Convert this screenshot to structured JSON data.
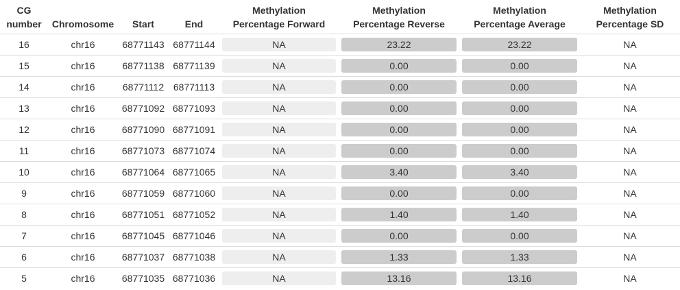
{
  "headers": {
    "cg_number": [
      "CG",
      "number"
    ],
    "chromosome": "Chromosome",
    "start": "Start",
    "end": "End",
    "forward": [
      "Methylation",
      "Percentage Forward"
    ],
    "reverse": [
      "Methylation",
      "Percentage Reverse"
    ],
    "average": [
      "Methylation",
      "Percentage Average"
    ],
    "sd": [
      "Methylation",
      "Percentage SD"
    ]
  },
  "rows": [
    {
      "cg": "16",
      "chr": "chr16",
      "start": "68771143",
      "end": "68771144",
      "forward": "NA",
      "reverse": "23.22",
      "average": "23.22",
      "sd": "NA"
    },
    {
      "cg": "15",
      "chr": "chr16",
      "start": "68771138",
      "end": "68771139",
      "forward": "NA",
      "reverse": "0.00",
      "average": "0.00",
      "sd": "NA"
    },
    {
      "cg": "14",
      "chr": "chr16",
      "start": "68771112",
      "end": "68771113",
      "forward": "NA",
      "reverse": "0.00",
      "average": "0.00",
      "sd": "NA"
    },
    {
      "cg": "13",
      "chr": "chr16",
      "start": "68771092",
      "end": "68771093",
      "forward": "NA",
      "reverse": "0.00",
      "average": "0.00",
      "sd": "NA"
    },
    {
      "cg": "12",
      "chr": "chr16",
      "start": "68771090",
      "end": "68771091",
      "forward": "NA",
      "reverse": "0.00",
      "average": "0.00",
      "sd": "NA"
    },
    {
      "cg": "11",
      "chr": "chr16",
      "start": "68771073",
      "end": "68771074",
      "forward": "NA",
      "reverse": "0.00",
      "average": "0.00",
      "sd": "NA"
    },
    {
      "cg": "10",
      "chr": "chr16",
      "start": "68771064",
      "end": "68771065",
      "forward": "NA",
      "reverse": "3.40",
      "average": "3.40",
      "sd": "NA"
    },
    {
      "cg": "9",
      "chr": "chr16",
      "start": "68771059",
      "end": "68771060",
      "forward": "NA",
      "reverse": "0.00",
      "average": "0.00",
      "sd": "NA"
    },
    {
      "cg": "8",
      "chr": "chr16",
      "start": "68771051",
      "end": "68771052",
      "forward": "NA",
      "reverse": "1.40",
      "average": "1.40",
      "sd": "NA"
    },
    {
      "cg": "7",
      "chr": "chr16",
      "start": "68771045",
      "end": "68771046",
      "forward": "NA",
      "reverse": "0.00",
      "average": "0.00",
      "sd": "NA"
    },
    {
      "cg": "6",
      "chr": "chr16",
      "start": "68771037",
      "end": "68771038",
      "forward": "NA",
      "reverse": "1.33",
      "average": "1.33",
      "sd": "NA"
    },
    {
      "cg": "5",
      "chr": "chr16",
      "start": "68771035",
      "end": "68771036",
      "forward": "NA",
      "reverse": "13.16",
      "average": "13.16",
      "sd": "NA"
    }
  ],
  "colors": {
    "text": "#333333",
    "row_border": "#dddddd",
    "bar_light": "#eeeeee",
    "bar_dark": "#cccccc"
  }
}
